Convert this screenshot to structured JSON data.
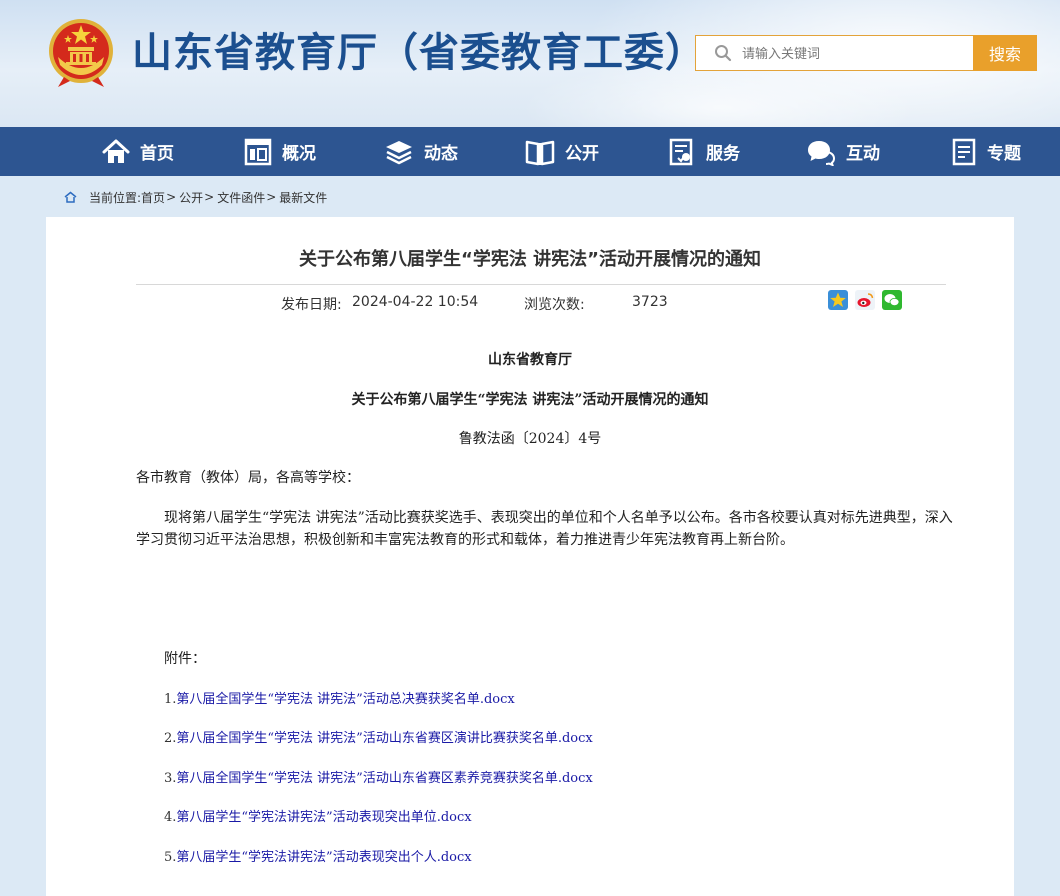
{
  "header": {
    "site_title": "山东省教育厅（省委教育工委）",
    "search_placeholder": "请输入关键词",
    "search_button": "搜索"
  },
  "nav": {
    "items": [
      {
        "label": "首页",
        "icon": "home-icon"
      },
      {
        "label": "概况",
        "icon": "overview-icon"
      },
      {
        "label": "动态",
        "icon": "news-layers-icon"
      },
      {
        "label": "公开",
        "icon": "open-book-icon"
      },
      {
        "label": "服务",
        "icon": "service-doc-icon"
      },
      {
        "label": "互动",
        "icon": "chat-bubble-icon"
      },
      {
        "label": "专题",
        "icon": "topic-doc-icon"
      }
    ]
  },
  "breadcrumb": {
    "prefix": "当前位置:",
    "items": [
      "首页",
      "公开",
      "文件函件",
      "最新文件"
    ],
    "separator": ">"
  },
  "article": {
    "title": "关于公布第八届学生“学宪法 讲宪法”活动开展情况的通知",
    "publish_label": "发布日期:",
    "publish_date": "2024-04-22 10:54",
    "views_label": "浏览次数:",
    "views": "3723",
    "share_icons": [
      "qzone-icon",
      "weibo-icon",
      "wechat-icon"
    ],
    "issuer": "山东省教育厅",
    "doc_title": "关于公布第八届学生“学宪法  讲宪法”活动开展情况的通知",
    "doc_number": "鲁教法函〔2024〕4号",
    "salutation": "各市教育（教体）局，各高等学校：",
    "body": "现将第八届学生“学宪法 讲宪法”活动比赛获奖选手、表现突出的单位和个人名单予以公布。各市各校要认真对标先进典型，深入学习贯彻习近平法治思想，积极创新和丰富宪法教育的形式和载体，着力推进青少年宪法教育再上新台阶。",
    "attachments_label": "附件：",
    "attachments": [
      {
        "num": "1.",
        "name": "第八届全国学生“学宪法 讲宪法”活动总决赛获奖名单.docx"
      },
      {
        "num": "2.",
        "name": "第八届全国学生“学宪法 讲宪法”活动山东省赛区演讲比赛获奖名单.docx"
      },
      {
        "num": "3.",
        "name": "第八届全国学生“学宪法 讲宪法”活动山东省赛区素养竞赛获奖名单.docx"
      },
      {
        "num": "4.",
        "name": "第八届学生“学宪法讲宪法”活动表现突出单位.docx"
      },
      {
        "num": "5.",
        "name": "第八届学生“学宪法讲宪法”活动表现突出个人.docx"
      }
    ]
  },
  "colors": {
    "nav_bg": "#2d5591",
    "title_blue": "#1b4f8f",
    "search_accent": "#e9a02b",
    "link": "#1a1aa6"
  }
}
